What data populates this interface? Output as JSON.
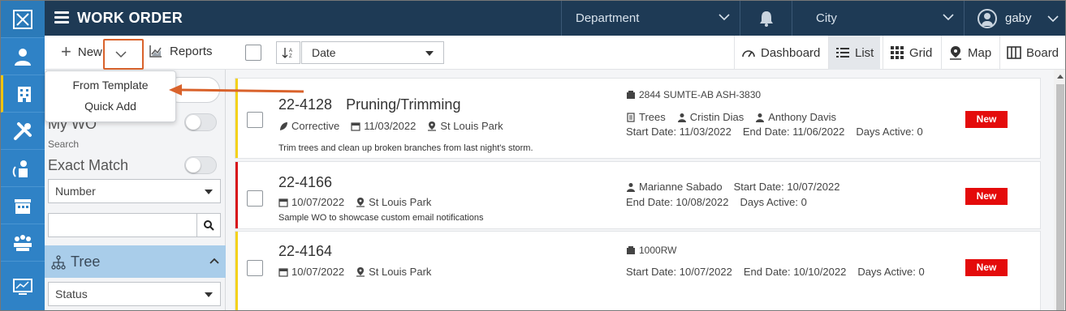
{
  "app": {
    "title": "WORK ORDER",
    "user": "gaby"
  },
  "header": {
    "department": "Department",
    "city": "City"
  },
  "sidebar_icons": [
    "logo-icon",
    "person-icon",
    "building-icon",
    "tools-icon",
    "worker-icon",
    "store-icon",
    "meeting-icon",
    "monitor-icon"
  ],
  "left_panel": {
    "new_label": "New",
    "reports_label": "Reports",
    "my_wo_label": "My WO",
    "search_caption": "Search",
    "exact_match_label": "Exact Match",
    "field_select": "Number",
    "search_value": "",
    "tree_label": "Tree",
    "status_select": "Status"
  },
  "new_menu": {
    "items": [
      "From Template",
      "Quick Add"
    ]
  },
  "toolbar": {
    "sort_value": "Date",
    "views": [
      "Dashboard",
      "List",
      "Grid",
      "Map",
      "Board"
    ],
    "active_view": "List"
  },
  "work_orders": [
    {
      "number": "22-4128",
      "name": "Pruning/Trimming",
      "type": "Corrective",
      "date": "11/03/2022",
      "location": "St Louis Park",
      "description": "Trim trees and clean up broken branches from last night's storm.",
      "asset": "2844 SUMTE-AB ASH-3830",
      "category": "Trees",
      "assignee1": "Cristin Dias",
      "assignee2": "Anthony Davis",
      "start": "Start Date: 11/03/2022",
      "end": "End Date: 11/06/2022",
      "days": "Days Active: 0",
      "status": "New",
      "bar_color": "#f4d21a"
    },
    {
      "number": "22-4166",
      "date": "10/07/2022",
      "location": "St Louis Park",
      "description": "Sample WO to showcase custom email notifications",
      "assignee": "Marianne Sabado",
      "start": "Start Date: 10/07/2022",
      "end": "End Date: 10/08/2022",
      "days": "Days Active: 0",
      "status": "New",
      "bar_color": "#d8141b"
    },
    {
      "number": "22-4164",
      "date": "10/07/2022",
      "location": "St Louis Park",
      "asset": "1000RW",
      "start": "Start Date: 10/07/2022",
      "end": "End Date: 10/10/2022",
      "days": "Days Active: 0",
      "status": "New",
      "bar_color": "#f4d21a"
    }
  ],
  "colors": {
    "rail": "#2f82c6",
    "header": "#1e3a55",
    "highlight": "#d9622b",
    "badge": "#e40b0b",
    "tree_bar": "#a9cdea"
  }
}
